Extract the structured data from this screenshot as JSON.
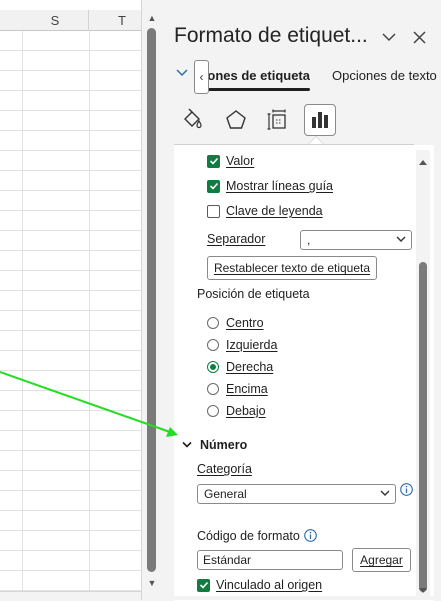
{
  "sheet": {
    "columns": [
      "S",
      "T"
    ],
    "scroll_up": "▲",
    "scroll_down": "▼"
  },
  "pane": {
    "title": "Formato de etiquet...",
    "dropdown_glyph": "⌄",
    "close_glyph": "✕",
    "tabs": {
      "back_glyph": "‹",
      "active": "Opciones de etiqueta",
      "other": "Opciones de texto"
    },
    "icons": [
      "fill-line-icon",
      "effects-icon",
      "size-properties-icon",
      "label-options-icon"
    ]
  },
  "options": {
    "valor": "Valor",
    "mostrar_lineas": "Mostrar líneas guía",
    "clave_leyenda": "Clave de leyenda",
    "separador_label": "Separador",
    "separador_value": ",",
    "reset_button": "Restablecer texto de etiqueta",
    "posicion_label": "Posición de etiqueta",
    "positions": [
      {
        "label": "Centro",
        "selected": false
      },
      {
        "label": "Izquierda",
        "selected": false
      },
      {
        "label": "Derecha",
        "selected": true
      },
      {
        "label": "Encima",
        "selected": false
      },
      {
        "label": "Debajo",
        "selected": false
      }
    ],
    "numero_header": "Número",
    "categoria_label": "Categoría",
    "categoria_value": "General",
    "codigo_label": "Código de formato",
    "codigo_value": "Estándar",
    "agregar_button": "Agregar",
    "vinculado": "Vinculado al origen"
  },
  "colors": {
    "accent_green": "#107c41",
    "annotation_arrow": "#22dd22"
  }
}
